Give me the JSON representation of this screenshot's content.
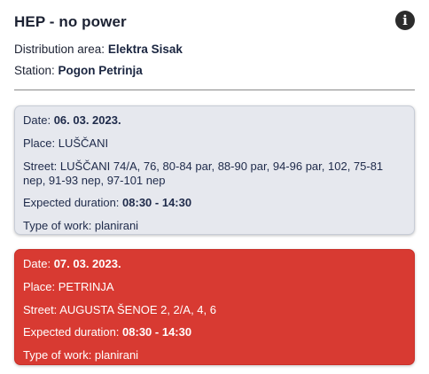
{
  "header": {
    "title": "HEP - no power",
    "info_icon": "info-icon"
  },
  "meta": {
    "area_label": "Distribution area: ",
    "area_value": "Elektra Sisak",
    "station_label": "Station: ",
    "station_value": "Pogon Petrinja"
  },
  "labels": {
    "date": "Date: ",
    "place": "Place: ",
    "street": "Street: ",
    "duration": "Expected duration: ",
    "type": "Type of work: "
  },
  "outages": [
    {
      "date": "06. 03. 2023.",
      "place": "LUŠČANI",
      "street": "LUŠČANI 74/A, 76, 80-84 par, 88-90 par, 94-96 par, 102, 75-81 nep, 91-93 nep, 97-101 nep",
      "duration": "08:30 - 14:30",
      "type": "planirani"
    },
    {
      "date": "07. 03. 2023.",
      "place": "PETRINJA",
      "street": "AUGUSTA ŠENOE 2, 2/A, 4, 6",
      "duration": "08:30 - 14:30",
      "type": "planirani"
    }
  ],
  "colors": {
    "future_card_bg": "#e6e8ee",
    "highlight_card_bg": "#d83a32",
    "text_dark": "#1c2233"
  }
}
